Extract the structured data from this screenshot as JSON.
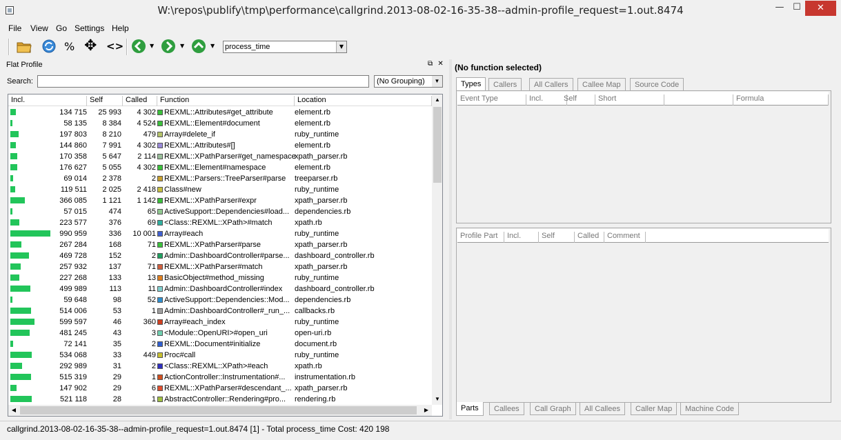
{
  "window": {
    "title": "W:\\repos\\publify\\tmp\\performance\\callgrind.2013-08-02-16-35-38--admin-profile_request=1.out.8474",
    "min": "—",
    "max": "☐",
    "close": "✕"
  },
  "menu": [
    "File",
    "View",
    "Go",
    "Settings",
    "Help"
  ],
  "toolbar": {
    "percent": "%",
    "move": "✥",
    "brackets": "<>",
    "event_type": "process_time"
  },
  "flat_profile": {
    "title": "Flat Profile",
    "search_label": "Search:",
    "search_value": "",
    "grouping": "(No Grouping)",
    "columns": [
      "Incl.",
      "Self",
      "Called",
      "Function",
      "Location"
    ],
    "accent_bar_color": "#22c55a",
    "rows": [
      {
        "incl": "134 715",
        "self": "25 993",
        "called": "4 302",
        "color": "#3cc03c",
        "function": "REXML::Attributes#get_attribute",
        "location": "element.rb",
        "incl_fraction": 0.136
      },
      {
        "incl": "58 135",
        "self": "8 384",
        "called": "4 524",
        "color": "#3cc03c",
        "function": "REXML::Element#document",
        "location": "element.rb",
        "incl_fraction": 0.059
      },
      {
        "incl": "197 803",
        "self": "8 210",
        "called": "479",
        "color": "#b5c46a",
        "function": "Array#delete_if",
        "location": "ruby_runtime",
        "incl_fraction": 0.2
      },
      {
        "incl": "144 860",
        "self": "7 991",
        "called": "4 302",
        "color": "#9a8ad8",
        "function": "REXML::Attributes#[]",
        "location": "element.rb",
        "incl_fraction": 0.146
      },
      {
        "incl": "170 358",
        "self": "5 647",
        "called": "2 114",
        "color": "#9abf9a",
        "function": "REXML::XPathParser#get_namespace",
        "location": "xpath_parser.rb",
        "incl_fraction": 0.172
      },
      {
        "incl": "176 627",
        "self": "5 055",
        "called": "4 302",
        "color": "#3cc03c",
        "function": "REXML::Element#namespace",
        "location": "element.rb",
        "incl_fraction": 0.178
      },
      {
        "incl": "69 014",
        "self": "2 378",
        "called": "2",
        "color": "#c8a030",
        "function": "REXML::Parsers::TreeParser#parse",
        "location": "treeparser.rb",
        "incl_fraction": 0.07
      },
      {
        "incl": "119 511",
        "self": "2 025",
        "called": "2 418",
        "color": "#c8c040",
        "function": "Class#new",
        "location": "ruby_runtime",
        "incl_fraction": 0.121
      },
      {
        "incl": "366 085",
        "self": "1 121",
        "called": "1 142",
        "color": "#3cc03c",
        "function": "REXML::XPathParser#expr",
        "location": "xpath_parser.rb",
        "incl_fraction": 0.369
      },
      {
        "incl": "57 015",
        "self": "474",
        "called": "65",
        "color": "#90c890",
        "function": "ActiveSupport::Dependencies#load...",
        "location": "dependencies.rb",
        "incl_fraction": 0.058
      },
      {
        "incl": "223 577",
        "self": "376",
        "called": "69",
        "color": "#30b0a0",
        "function": "<Class::REXML::XPath>#match",
        "location": "xpath.rb",
        "incl_fraction": 0.226
      },
      {
        "incl": "990 959",
        "self": "336",
        "called": "10 001",
        "color": "#4060d0",
        "function": "Array#each",
        "location": "ruby_runtime",
        "incl_fraction": 1.0
      },
      {
        "incl": "267 284",
        "self": "168",
        "called": "71",
        "color": "#3cc03c",
        "function": "REXML::XPathParser#parse",
        "location": "xpath_parser.rb",
        "incl_fraction": 0.27
      },
      {
        "incl": "469 728",
        "self": "152",
        "called": "2",
        "color": "#20a060",
        "function": "Admin::DashboardController#parse...",
        "location": "dashboard_controller.rb",
        "incl_fraction": 0.474
      },
      {
        "incl": "257 932",
        "self": "137",
        "called": "71",
        "color": "#d06040",
        "function": "REXML::XPathParser#match",
        "location": "xpath_parser.rb",
        "incl_fraction": 0.26
      },
      {
        "incl": "227 268",
        "self": "133",
        "called": "13",
        "color": "#e08020",
        "function": "BasicObject#method_missing",
        "location": "ruby_runtime",
        "incl_fraction": 0.229
      },
      {
        "incl": "499 989",
        "self": "113",
        "called": "11",
        "color": "#80d0d0",
        "function": "Admin::DashboardController#index",
        "location": "dashboard_controller.rb",
        "incl_fraction": 0.505
      },
      {
        "incl": "59 648",
        "self": "98",
        "called": "52",
        "color": "#3090d0",
        "function": "ActiveSupport::Dependencies::Mod...",
        "location": "dependencies.rb",
        "incl_fraction": 0.06
      },
      {
        "incl": "514 006",
        "self": "53",
        "called": "1",
        "color": "#a0a0a0",
        "function": "Admin::DashboardController#_run_...",
        "location": "callbacks.rb",
        "incl_fraction": 0.519
      },
      {
        "incl": "599 597",
        "self": "46",
        "called": "360",
        "color": "#d04020",
        "function": "Array#each_index",
        "location": "ruby_runtime",
        "incl_fraction": 0.605
      },
      {
        "incl": "481 245",
        "self": "43",
        "called": "3",
        "color": "#70d0b0",
        "function": "<Module::OpenURI>#open_uri",
        "location": "open-uri.rb",
        "incl_fraction": 0.486
      },
      {
        "incl": "72 141",
        "self": "35",
        "called": "2",
        "color": "#3060d0",
        "function": "REXML::Document#initialize",
        "location": "document.rb",
        "incl_fraction": 0.073
      },
      {
        "incl": "534 068",
        "self": "33",
        "called": "449",
        "color": "#c8c030",
        "function": "Proc#call",
        "location": "ruby_runtime",
        "incl_fraction": 0.539
      },
      {
        "incl": "292 989",
        "self": "31",
        "called": "2",
        "color": "#3030c0",
        "function": "<Class::REXML::XPath>#each",
        "location": "xpath.rb",
        "incl_fraction": 0.296
      },
      {
        "incl": "515 319",
        "self": "29",
        "called": "1",
        "color": "#d05020",
        "function": "ActionController::Instrumentation#...",
        "location": "instrumentation.rb",
        "incl_fraction": 0.52
      },
      {
        "incl": "147 902",
        "self": "29",
        "called": "6",
        "color": "#e05030",
        "function": "REXML::XPathParser#descendant_...",
        "location": "xpath_parser.rb",
        "incl_fraction": 0.149
      },
      {
        "incl": "521 118",
        "self": "28",
        "called": "1",
        "color": "#a0c040",
        "function": "AbstractController::Rendering#pro...",
        "location": "rendering.rb",
        "incl_fraction": 0.526
      }
    ]
  },
  "details": {
    "title": "(No function selected)",
    "top_tabs": [
      "Types",
      "Callers",
      "All Callers",
      "Callee Map",
      "Source Code"
    ],
    "types_columns": [
      "Event Type",
      "Incl.",
      "Self",
      "Short",
      "",
      "Formula"
    ],
    "parts_columns": [
      "Profile Part",
      "Incl.",
      "Self",
      "Called",
      "Comment"
    ],
    "bottom_tabs": [
      "Parts",
      "Callees",
      "Call Graph",
      "All Callees",
      "Caller Map",
      "Machine Code"
    ]
  },
  "status": "callgrind.2013-08-02-16-35-38--admin-profile_request=1.out.8474 [1] - Total process_time Cost: 420 198"
}
